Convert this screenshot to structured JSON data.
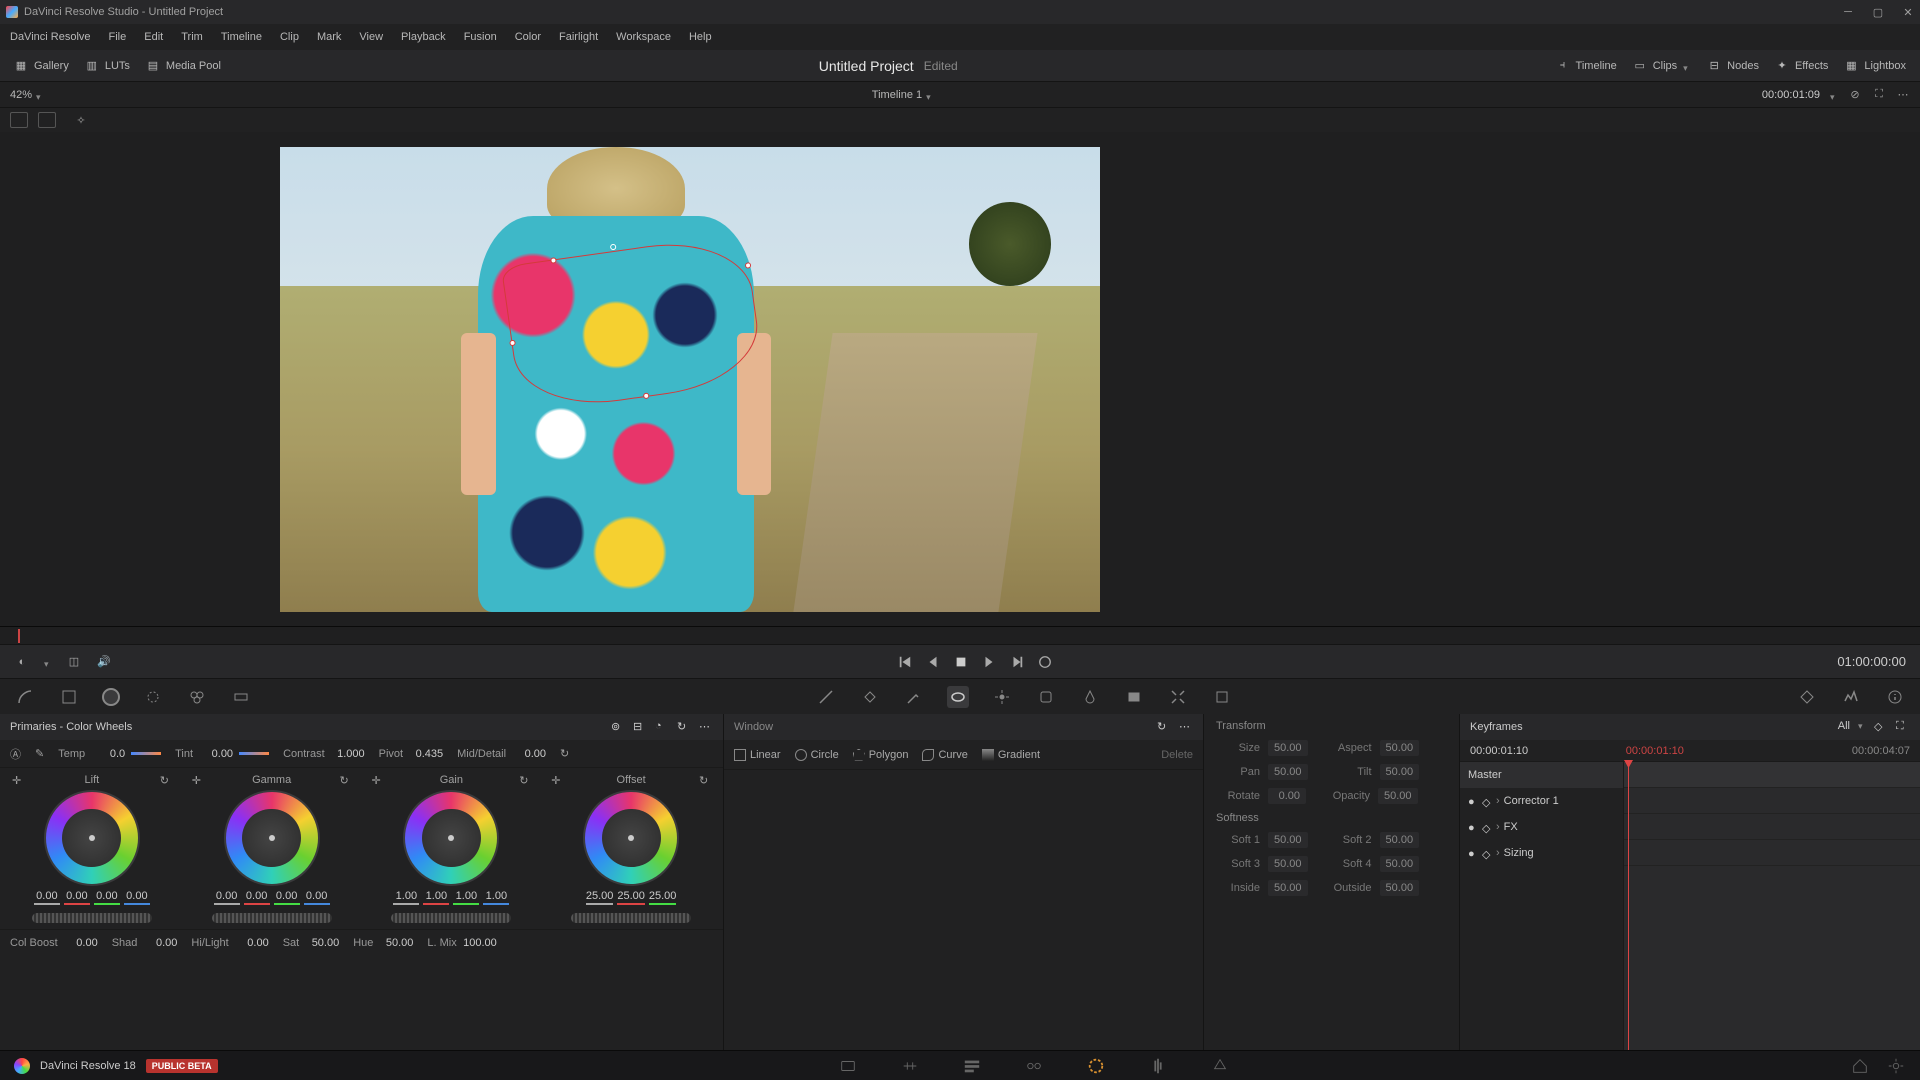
{
  "titlebar": {
    "title": "DaVinci Resolve Studio - Untitled Project"
  },
  "menubar": [
    "DaVinci Resolve",
    "File",
    "Edit",
    "Trim",
    "Timeline",
    "Clip",
    "Mark",
    "View",
    "Playback",
    "Fusion",
    "Color",
    "Fairlight",
    "Workspace",
    "Help"
  ],
  "toolbar": {
    "left": [
      {
        "icon": "gallery-icon",
        "label": "Gallery"
      },
      {
        "icon": "luts-icon",
        "label": "LUTs"
      },
      {
        "icon": "mediapool-icon",
        "label": "Media Pool"
      }
    ],
    "project_title": "Untitled Project",
    "project_status": "Edited",
    "right": [
      {
        "icon": "timeline-icon",
        "label": "Timeline"
      },
      {
        "icon": "clips-icon",
        "label": "Clips"
      },
      {
        "icon": "nodes-icon",
        "label": "Nodes"
      },
      {
        "icon": "effects-icon",
        "label": "Effects"
      },
      {
        "icon": "lightbox-icon",
        "label": "Lightbox"
      }
    ]
  },
  "secondbar": {
    "zoom": "42%",
    "timeline_name": "Timeline 1",
    "timecode": "00:00:01:09"
  },
  "transport": {
    "timecode": "01:00:00:00"
  },
  "primaries": {
    "title": "Primaries - Color Wheels",
    "params_top": {
      "temp": {
        "label": "Temp",
        "value": "0.0"
      },
      "tint": {
        "label": "Tint",
        "value": "0.00"
      },
      "contrast": {
        "label": "Contrast",
        "value": "1.000"
      },
      "pivot": {
        "label": "Pivot",
        "value": "0.435"
      },
      "middetail": {
        "label": "Mid/Detail",
        "value": "0.00"
      }
    },
    "wheels": [
      {
        "name": "Lift",
        "vals": [
          "0.00",
          "0.00",
          "0.00",
          "0.00"
        ]
      },
      {
        "name": "Gamma",
        "vals": [
          "0.00",
          "0.00",
          "0.00",
          "0.00"
        ]
      },
      {
        "name": "Gain",
        "vals": [
          "1.00",
          "1.00",
          "1.00",
          "1.00"
        ]
      },
      {
        "name": "Offset",
        "vals": [
          "25.00",
          "25.00",
          "25.00"
        ]
      }
    ],
    "params_bottom": {
      "colboost": {
        "label": "Col Boost",
        "value": "0.00"
      },
      "shad": {
        "label": "Shad",
        "value": "0.00"
      },
      "hilight": {
        "label": "Hi/Light",
        "value": "0.00"
      },
      "sat": {
        "label": "Sat",
        "value": "50.00"
      },
      "hue": {
        "label": "Hue",
        "value": "50.00"
      },
      "lmix": {
        "label": "L. Mix",
        "value": "100.00"
      }
    }
  },
  "window": {
    "title": "Window",
    "tools": [
      {
        "icon": "linear-icon",
        "label": "Linear"
      },
      {
        "icon": "circle-icon",
        "label": "Circle"
      },
      {
        "icon": "polygon-icon",
        "label": "Polygon"
      },
      {
        "icon": "curve-icon",
        "label": "Curve"
      },
      {
        "icon": "gradient-icon",
        "label": "Gradient"
      }
    ],
    "delete": "Delete"
  },
  "transform": {
    "title": "Transform",
    "fields": {
      "size": {
        "label": "Size",
        "value": "50.00"
      },
      "aspect": {
        "label": "Aspect",
        "value": "50.00"
      },
      "pan": {
        "label": "Pan",
        "value": "50.00"
      },
      "tilt": {
        "label": "Tilt",
        "value": "50.00"
      },
      "rotate": {
        "label": "Rotate",
        "value": "0.00"
      },
      "opacity": {
        "label": "Opacity",
        "value": "50.00"
      }
    },
    "softness_title": "Softness",
    "softness": {
      "soft1": {
        "label": "Soft 1",
        "value": "50.00"
      },
      "soft2": {
        "label": "Soft 2",
        "value": "50.00"
      },
      "soft3": {
        "label": "Soft 3",
        "value": "50.00"
      },
      "soft4": {
        "label": "Soft 4",
        "value": "50.00"
      },
      "inside": {
        "label": "Inside",
        "value": "50.00"
      },
      "outside": {
        "label": "Outside",
        "value": "50.00"
      }
    }
  },
  "keyframes": {
    "title": "Keyframes",
    "filter": "All",
    "tc1": "00:00:01:10",
    "tc2": "00:00:01:10",
    "tc3": "00:00:04:07",
    "tree": [
      "Master",
      "Corrector 1",
      "FX",
      "Sizing"
    ]
  },
  "statusbar": {
    "app": "DaVinci Resolve 18",
    "beta": "PUBLIC BETA"
  }
}
